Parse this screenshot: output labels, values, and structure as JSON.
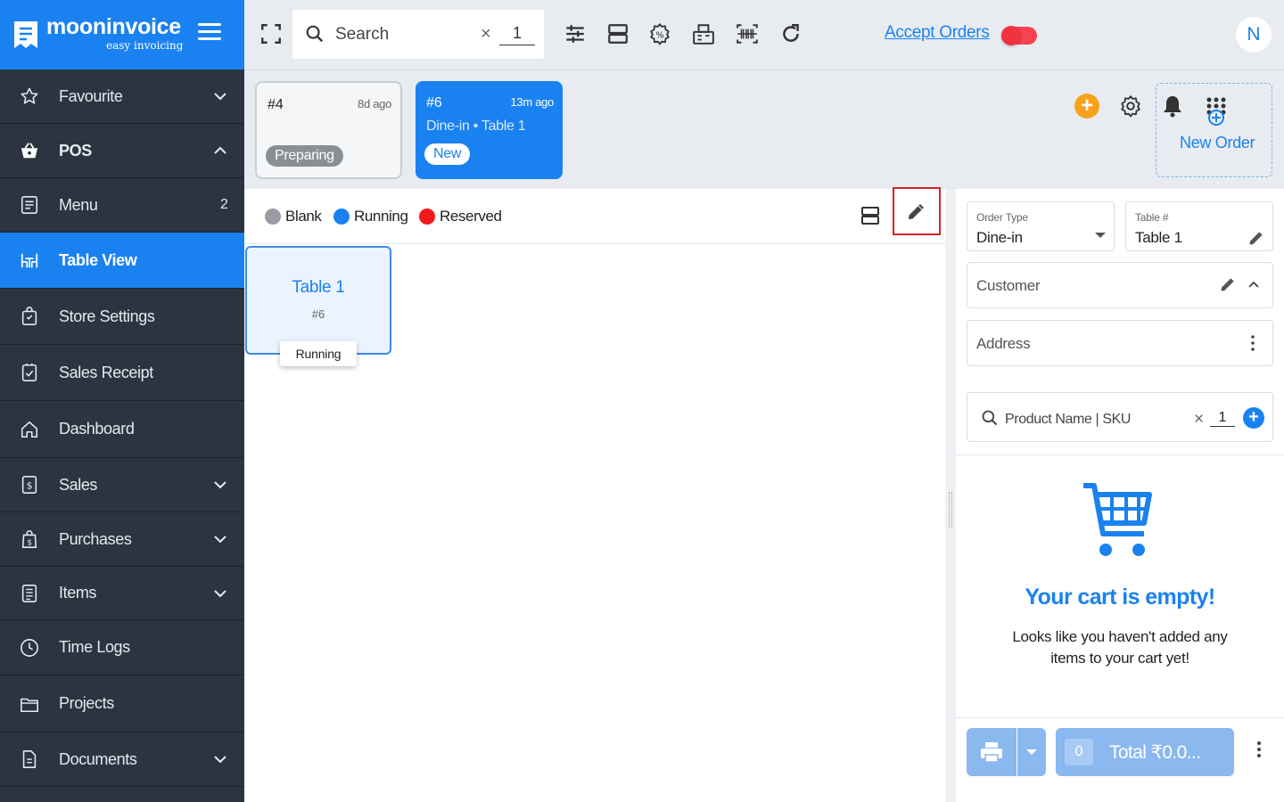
{
  "brand": {
    "name": "mooninvoice",
    "tagline": "easy invoicing"
  },
  "sidebar": {
    "items": [
      {
        "label": "Favourite",
        "icon": "star-icon",
        "caret": "down"
      },
      {
        "label": "POS",
        "icon": "basket-icon",
        "caret": "up"
      },
      {
        "label": "Menu",
        "icon": "menu-list-icon",
        "count": "2"
      },
      {
        "label": "Table View",
        "icon": "table-icon",
        "active": true
      },
      {
        "label": "Store Settings",
        "icon": "store-bag-icon"
      },
      {
        "label": "Sales Receipt",
        "icon": "receipt-check-icon"
      },
      {
        "label": "Dashboard",
        "icon": "home-icon"
      },
      {
        "label": "Sales",
        "icon": "dollar-doc-icon",
        "caret": "down"
      },
      {
        "label": "Purchases",
        "icon": "shopping-bag-dollar-icon",
        "caret": "down"
      },
      {
        "label": "Items",
        "icon": "list-doc-icon",
        "caret": "down"
      },
      {
        "label": "Time Logs",
        "icon": "clock-icon"
      },
      {
        "label": "Projects",
        "icon": "folder-icon"
      },
      {
        "label": "Documents",
        "icon": "document-icon",
        "caret": "down"
      }
    ]
  },
  "topbar": {
    "search_placeholder": "Search",
    "search_clear": "×",
    "quantity": "1",
    "accept_orders_label": "Accept Orders",
    "accept_orders_on": false,
    "user_initial": "N"
  },
  "orders": [
    {
      "number": "#4",
      "time": "8d ago",
      "subtitle": "",
      "status": "Preparing"
    },
    {
      "number": "#6",
      "time": "13m ago",
      "subtitle": "Dine-in • Table 1",
      "status": "New"
    }
  ],
  "new_order_label": "New Order",
  "legend": [
    {
      "label": "Blank",
      "color": "#9a9da3"
    },
    {
      "label": "Running",
      "color": "#1a82f0"
    },
    {
      "label": "Reserved",
      "color": "#f01a1a"
    }
  ],
  "tables": [
    {
      "name": "Table 1",
      "order": "#6",
      "status": "Running"
    }
  ],
  "order_panel": {
    "order_type_label": "Order Type",
    "order_type_value": "Dine-in",
    "table_label": "Table #",
    "table_value": "Table 1",
    "customer_placeholder": "Customer",
    "address_placeholder": "Address",
    "product_search_placeholder": "Product Name | SKU",
    "product_clear": "×",
    "product_qty": "1",
    "cart_empty_title": "Your cart is empty!",
    "cart_empty_message": "Looks like you haven't added any items to your cart yet!",
    "cart_count": "0",
    "total_label": "Total ₹0.0..."
  },
  "colors": {
    "accent": "#1a82f0",
    "sidebar_bg": "#2b3440",
    "toggle": "#f21e2c",
    "add_button": "#f7a21a"
  }
}
